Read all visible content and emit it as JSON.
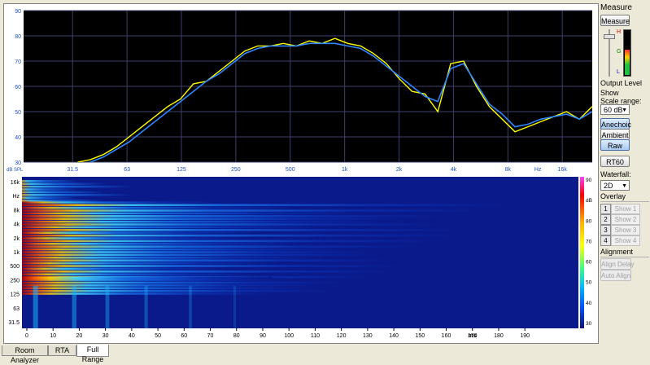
{
  "freq_chart": {
    "y_ticks": [
      "90",
      "80",
      "70",
      "60",
      "50",
      "40",
      "30"
    ],
    "x_ticks": [
      "31.5",
      "63",
      "125",
      "250",
      "500",
      "1k",
      "2k",
      "4k",
      "8k",
      "16k"
    ],
    "x_unit": "Hz",
    "y_unit": "dB SPL",
    "colors": {
      "raw": "#ffff00",
      "smoothed": "#2e86ff",
      "bg": "#000000",
      "grid": "#3f3f6e",
      "axis_label": "#1e4fc0"
    }
  },
  "waterfall_chart": {
    "y_ticks": [
      "16k",
      "Hz",
      "8k",
      "4k",
      "2k",
      "1k",
      "500",
      "250",
      "125",
      "63",
      "31.5"
    ],
    "x_ticks": [
      "0",
      "10",
      "20",
      "30",
      "40",
      "50",
      "60",
      "70",
      "80",
      "90",
      "100",
      "110",
      "120",
      "130",
      "140",
      "150",
      "160",
      "170",
      "180",
      "190"
    ],
    "x_unit": "ms",
    "scale_ticks": [
      "90",
      "dB",
      "80",
      "70",
      "60",
      "50",
      "40",
      "30"
    ]
  },
  "chart_data": [
    {
      "type": "line",
      "series": [
        {
          "values": [
            30,
            31,
            33,
            36,
            40,
            44,
            48,
            52,
            55,
            61,
            62,
            66,
            70,
            74,
            76,
            76,
            77,
            76,
            78,
            77,
            79,
            77,
            76,
            73,
            69,
            63,
            58,
            57,
            50,
            69,
            70,
            60,
            52,
            47,
            42,
            44,
            46,
            48,
            50,
            47,
            52
          ]
        },
        {
          "values": [
            29,
            30,
            32,
            35,
            38,
            42,
            46,
            50,
            54,
            58,
            62,
            65,
            69,
            73,
            75,
            76,
            76,
            76,
            77,
            77,
            77,
            76,
            75,
            72,
            68,
            64,
            60,
            56,
            54,
            67,
            69,
            61,
            53,
            49,
            44,
            45,
            47,
            48,
            49,
            47,
            50
          ]
        }
      ],
      "ylim": [
        30,
        90
      ]
    },
    {
      "type": "heatmap",
      "zlim": [
        30,
        90
      ]
    }
  ],
  "sidebar": {
    "measure_label": "Measure",
    "measure_button": "Measure",
    "meter": {
      "h_label": "H",
      "g_label": "G",
      "l_label": "L",
      "level": 0.55
    },
    "output_level": "Output Level",
    "show_label": "Show",
    "scale_range_label": "Scale range:",
    "scale_range_value": "60 dB",
    "anechoic": "Anechoic",
    "ambient": "Ambient",
    "raw": "Raw",
    "rt60": "RT60",
    "waterfall_label": "Waterfall:",
    "waterfall_value": "2D",
    "overlay_label": "Overlay",
    "overlays": [
      {
        "num": "1",
        "show": "Show 1"
      },
      {
        "num": "2",
        "show": "Show 2"
      },
      {
        "num": "3",
        "show": "Show 3"
      },
      {
        "num": "4",
        "show": "Show 4"
      }
    ],
    "alignment_label": "Alignment",
    "align_delay": "Align Delay",
    "auto_align": "Auto Align"
  },
  "tabs": [
    {
      "label": "Room Analyzer"
    },
    {
      "label": "RTA"
    },
    {
      "label": "Full Range"
    }
  ]
}
